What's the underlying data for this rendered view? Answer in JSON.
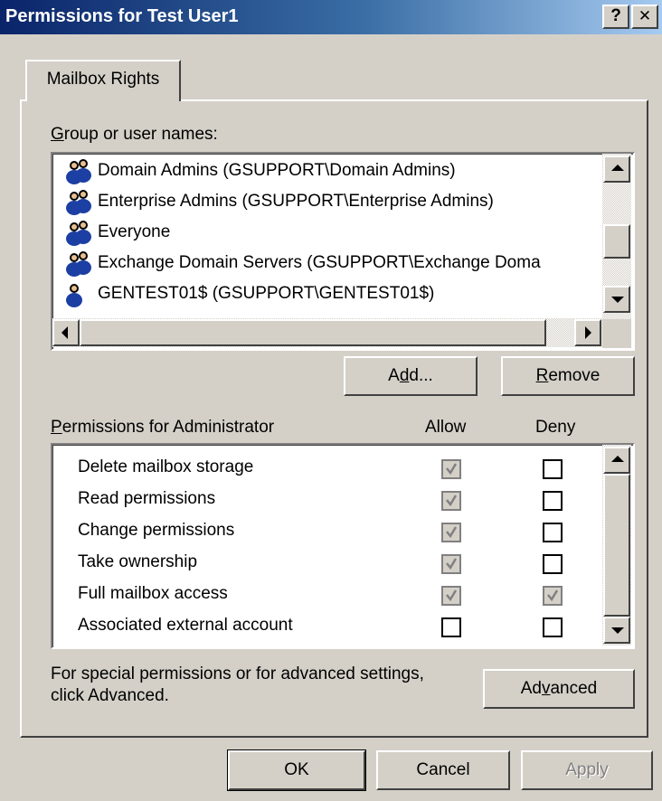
{
  "window": {
    "title": "Permissions for Test User1",
    "help_button": "?",
    "close_button": "✕"
  },
  "tabs": [
    {
      "label": "Mailbox Rights",
      "selected": true
    }
  ],
  "group_list": {
    "label": "Group or user names:",
    "label_mnemonic": "G",
    "label_rest": "roup or user names:",
    "items": [
      {
        "name": "Domain Admins (GSUPPORT\\Domain Admins)",
        "icon": "group-icon"
      },
      {
        "name": "Enterprise Admins (GSUPPORT\\Enterprise Admins)",
        "icon": "group-icon"
      },
      {
        "name": "Everyone",
        "icon": "group-icon"
      },
      {
        "name": "Exchange Domain Servers (GSUPPORT\\Exchange Doma",
        "icon": "group-icon"
      },
      {
        "name": "GENTEST01$ (GSUPPORT\\GENTEST01$)",
        "icon": "computer-icon"
      }
    ]
  },
  "buttons": {
    "add": {
      "pre": "A",
      "mnemonic": "d",
      "post": "d..."
    },
    "remove": {
      "pre": "",
      "mnemonic": "R",
      "post": "emove"
    },
    "advanced": {
      "pre": "Ad",
      "mnemonic": "v",
      "post": "anced"
    },
    "ok": "OK",
    "cancel": "Cancel",
    "apply": "Apply"
  },
  "permissions": {
    "header_mnemonic": "P",
    "header_rest": "ermissions for Administrator",
    "header": "Permissions for Administrator",
    "allow_label": "Allow",
    "deny_label": "Deny",
    "rows": [
      {
        "name": "Delete mailbox storage",
        "allow": "checked-disabled",
        "deny": "unchecked"
      },
      {
        "name": "Read permissions",
        "allow": "checked-disabled",
        "deny": "unchecked"
      },
      {
        "name": "Change permissions",
        "allow": "checked-disabled",
        "deny": "unchecked"
      },
      {
        "name": "Take ownership",
        "allow": "checked-disabled",
        "deny": "unchecked"
      },
      {
        "name": "Full mailbox access",
        "allow": "checked-disabled",
        "deny": "checked-disabled"
      },
      {
        "name": "Associated external account",
        "allow": "unchecked",
        "deny": "unchecked"
      }
    ]
  },
  "advanced_note": {
    "line1": "For special permissions or for advanced settings,",
    "line2": "click Advanced."
  },
  "colors": {
    "face": "#d4d0c8",
    "title_start": "#0a246a",
    "title_end": "#a6caf0"
  }
}
